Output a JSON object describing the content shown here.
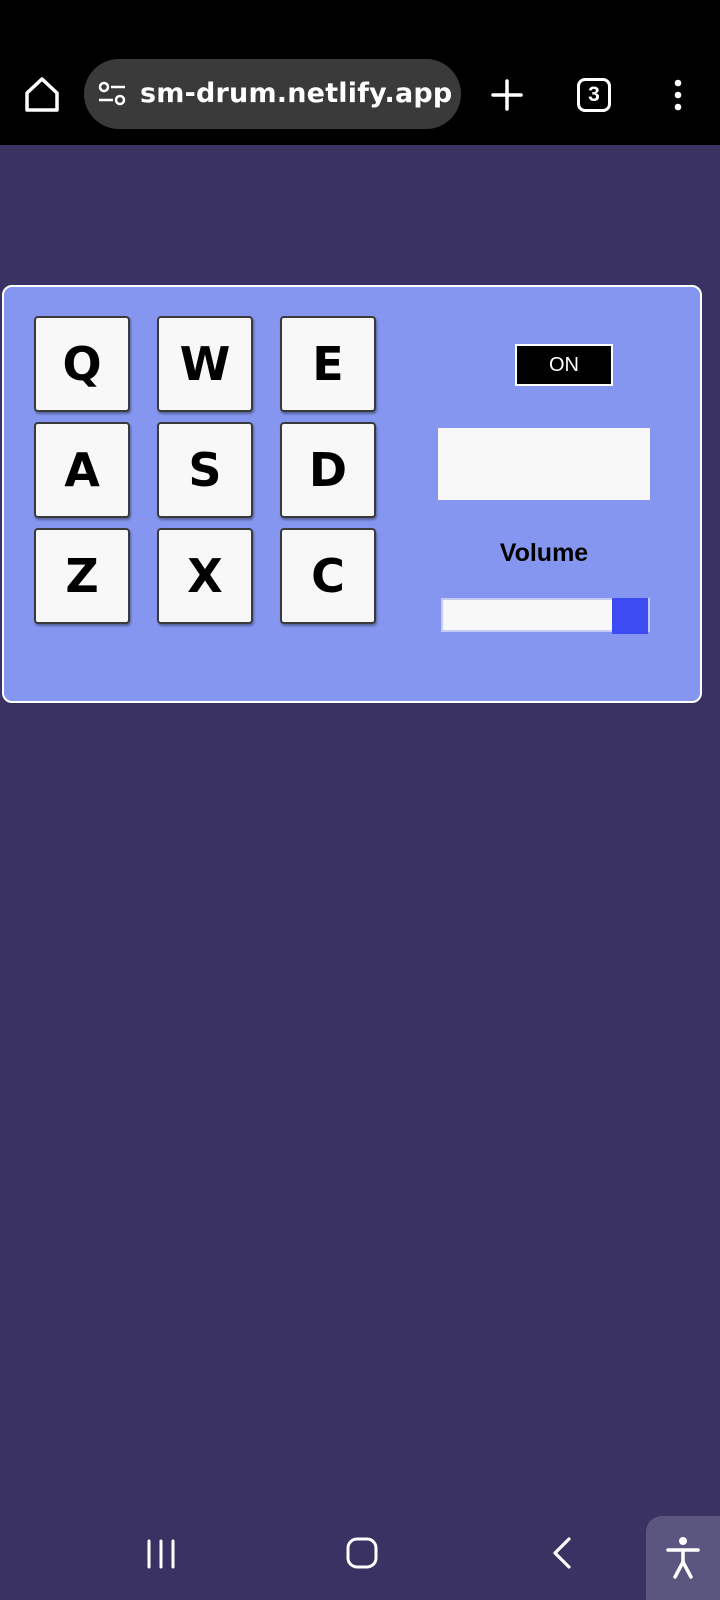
{
  "browser": {
    "url": "sm-drum.netlify.app",
    "tab_count": "3",
    "icons": {
      "home": "home-icon",
      "site_settings": "tune-icon",
      "new_tab": "plus-icon",
      "tabs": "tabs-icon",
      "menu": "more-vertical-icon"
    }
  },
  "drum_machine": {
    "pads": [
      {
        "key": "Q"
      },
      {
        "key": "W"
      },
      {
        "key": "E"
      },
      {
        "key": "A"
      },
      {
        "key": "S"
      },
      {
        "key": "D"
      },
      {
        "key": "Z"
      },
      {
        "key": "X"
      },
      {
        "key": "C"
      }
    ],
    "power_label": "ON",
    "display_text": "",
    "volume_label": "Volume",
    "volume_level": 1.0,
    "colors": {
      "page_background": "#393263",
      "panel": "#8496ef",
      "pad": "#f8f8f8",
      "slider_thumb": "#3d4cf2"
    }
  },
  "system_nav": {
    "icons": {
      "recents": "recents-icon",
      "home": "home-outline-icon",
      "back": "back-icon",
      "accessibility": "accessibility-icon"
    }
  }
}
